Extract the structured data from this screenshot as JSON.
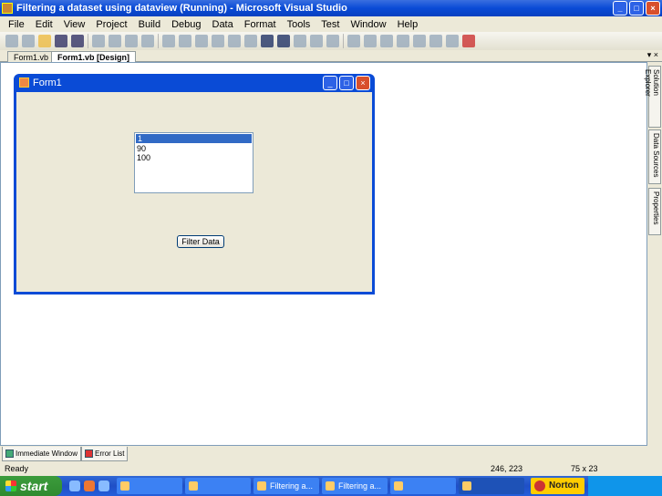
{
  "window": {
    "title": "Filtering a dataset using dataview (Running) - Microsoft Visual Studio"
  },
  "menu": [
    "File",
    "Edit",
    "View",
    "Project",
    "Build",
    "Debug",
    "Data",
    "Format",
    "Tools",
    "Test",
    "Window",
    "Help"
  ],
  "doc_tabs": [
    {
      "label": "Form1.vb"
    },
    {
      "label": "Form1.vb [Design]"
    }
  ],
  "doc_controls": "▾ ×",
  "form": {
    "title": "Form1",
    "list_items": [
      "1",
      "90",
      "100"
    ],
    "button": "Filter Data"
  },
  "side_tabs": [
    "Solution Explorer",
    "Data Sources",
    "Properties"
  ],
  "bottom_tabs": [
    "Immediate Window",
    "Error List"
  ],
  "status": {
    "text": "Ready",
    "position": "246, 223",
    "size": "75 x 23"
  },
  "taskbar": {
    "start": "start",
    "tasks": [
      "",
      "",
      "Filtering a...",
      "Filtering a...",
      "",
      ""
    ],
    "norton": "Norton"
  }
}
